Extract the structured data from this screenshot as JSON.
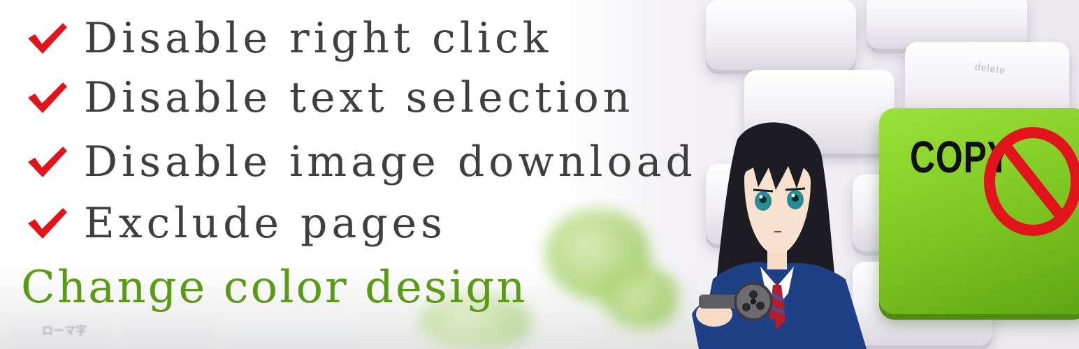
{
  "features": [
    {
      "icon": "red-check-icon",
      "text": "Disable right click"
    },
    {
      "icon": "red-check-icon",
      "text": "Disable text selection"
    },
    {
      "icon": "red-check-icon",
      "text": "Disable image download"
    },
    {
      "icon": "red-check-icon",
      "text": "Exclude pages"
    }
  ],
  "highlight": "Change color design",
  "copy_key": {
    "label": "COPY",
    "icon": "no-sign-icon"
  },
  "keyboard": {
    "delete_label": "delete",
    "small_label": "ローマ字"
  },
  "colors": {
    "check": "#e0141b",
    "feature_text": "#3f3f3f",
    "highlight": "#5a9a14",
    "copy_key": "#7cc521",
    "no_sign": "#e2141b"
  }
}
